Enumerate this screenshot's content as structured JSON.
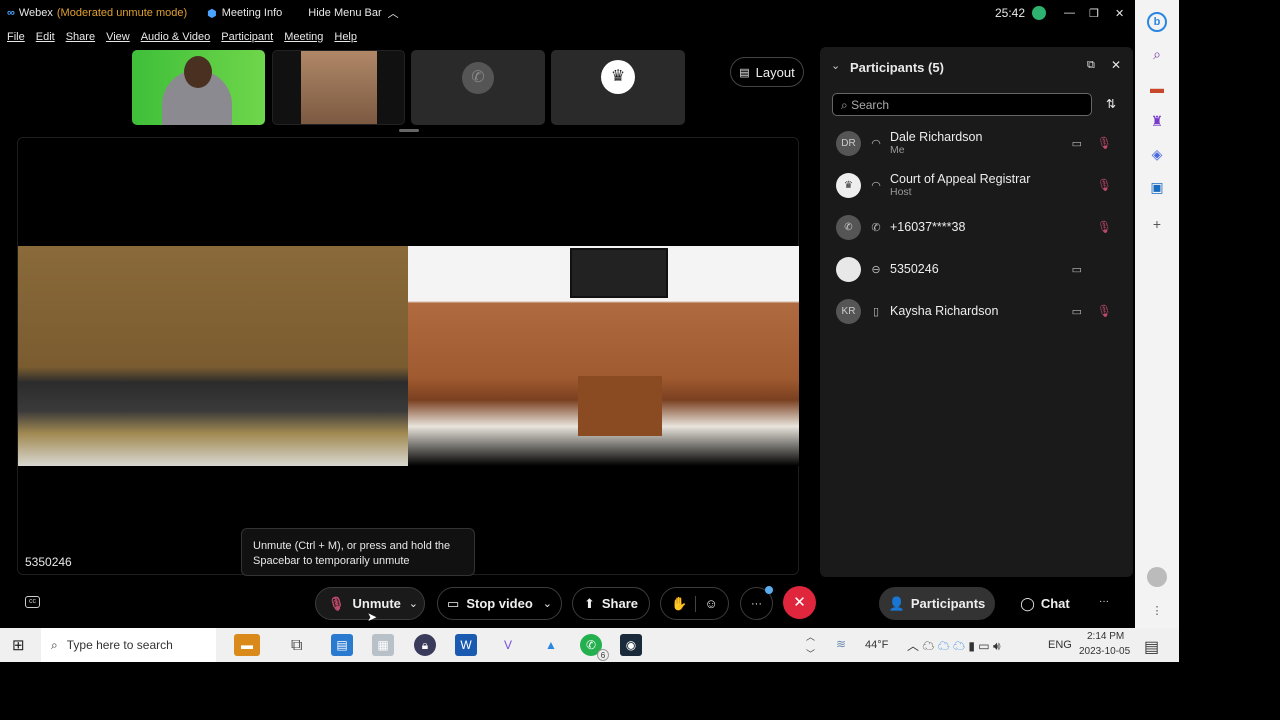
{
  "titlebar": {
    "app": "Webex",
    "mode": "(Moderated unmute mode)",
    "meeting_info": "Meeting Info",
    "hide_menu": "Hide Menu Bar",
    "timer": "25:42"
  },
  "menu": [
    "File",
    "Edit",
    "Share",
    "View",
    "Audio & Video",
    "Participant",
    "Meeting",
    "Help"
  ],
  "layout_label": "Layout",
  "stage": {
    "name_label": "5350246"
  },
  "tooltip": {
    "text": "Unmute (Ctrl + M), or press and hold the Spacebar to temporarily unmute"
  },
  "controls": {
    "unmute": "Unmute",
    "stop_video": "Stop video",
    "share": "Share",
    "participants": "Participants",
    "chat": "Chat",
    "more": "···"
  },
  "participants_panel": {
    "title": "Participants (5)",
    "search_placeholder": "Search",
    "list": [
      {
        "initials": "DR",
        "name": "Dale Richardson",
        "sub": "Me",
        "device": "headset",
        "video": true,
        "muted": true
      },
      {
        "initials": "",
        "name": "Court of Appeal Registrar",
        "sub": "Host",
        "device": "headset",
        "video": false,
        "muted": true
      },
      {
        "initials": "",
        "name": "+16037****38",
        "sub": "",
        "device": "phone",
        "video": false,
        "muted": true
      },
      {
        "initials": "",
        "name": "5350246",
        "sub": "",
        "device": "video-system",
        "video": true,
        "muted": false
      },
      {
        "initials": "KR",
        "name": "Kaysha Richardson",
        "sub": "",
        "device": "mobile",
        "video": true,
        "muted": true
      }
    ]
  },
  "taskbar": {
    "search_placeholder": "Type here to search",
    "weather": "44°F",
    "lang": "ENG",
    "time": "2:14 PM",
    "date": "2023-10-05",
    "whatsapp_badge": "6"
  },
  "colors": {
    "accent_mode": "#e0a030",
    "end_call": "#e0263c",
    "mute_red": "#c24a6c"
  }
}
